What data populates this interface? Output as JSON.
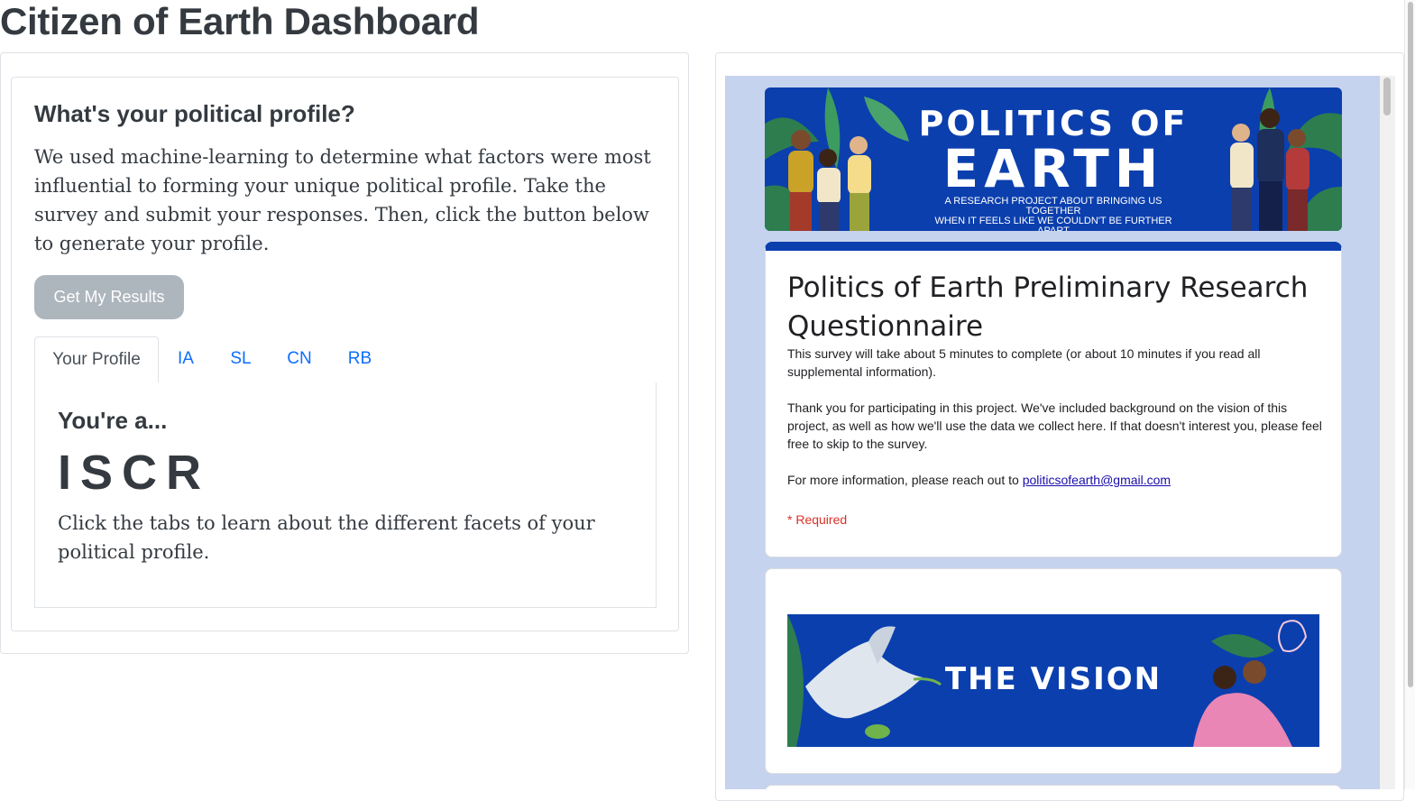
{
  "page": {
    "title": "Citizen of Earth Dashboard"
  },
  "profile_card": {
    "heading": "What's your political profile?",
    "description": "We used machine-learning to determine what factors were most influential to forming your unique political profile. Take the survey and submit your responses. Then, click the button below to generate your profile.",
    "button_label": "Get My Results"
  },
  "tabs": [
    {
      "label": "Your Profile",
      "active": true
    },
    {
      "label": "IA",
      "active": false
    },
    {
      "label": "SL",
      "active": false
    },
    {
      "label": "CN",
      "active": false
    },
    {
      "label": "RB",
      "active": false
    }
  ],
  "tab_content": {
    "heading": "You're a...",
    "code": "ISCR",
    "note": "Click the tabs to learn about the different facets of your political profile."
  },
  "form": {
    "banner": {
      "line1": "POLITICS OF",
      "line2": "EARTH",
      "subtitle_line1": "A RESEARCH PROJECT ABOUT BRINGING US TOGETHER",
      "subtitle_line2": "WHEN IT FEELS LIKE WE COULDN'T BE FURTHER APART"
    },
    "title": "Politics of Earth Preliminary Research Questionnaire",
    "paragraph1": "This survey will take about 5 minutes to complete (or about 10 minutes if you read all supplemental information).",
    "paragraph2": "Thank you for participating in this project. We've included background on the vision of this project, as well as how we'll use the data we collect here. If that doesn't interest you, please feel free to skip to the survey.",
    "contact_prefix": "For more information, please reach out to ",
    "contact_email": "politicsofearth@gmail.com",
    "required_note": "* Required",
    "vision_title": "THE VISION"
  },
  "colors": {
    "accent": "#0d6efd",
    "banner_blue": "#0b3fae",
    "form_background": "#c6d3ee",
    "required_red": "#d93025",
    "button_gray": "#adb5bd"
  },
  "icons": [
    "people-illustration",
    "dove-illustration",
    "leaf-illustration"
  ]
}
